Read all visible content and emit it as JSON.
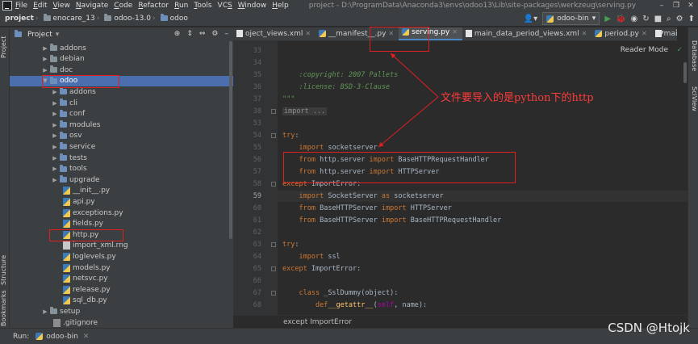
{
  "menu": {
    "items": [
      "File",
      "Edit",
      "View",
      "Navigate",
      "Code",
      "Refactor",
      "Run",
      "Tools",
      "VCS",
      "Window",
      "Help"
    ],
    "underlines": [
      "F",
      "E",
      "V",
      "N",
      "C",
      "R",
      "R",
      "T",
      "S",
      "W",
      "H"
    ],
    "window_title": "project - D:\\ProgramData\\Anaconda3\\envs\\odoo13\\Lib\\site-packages\\werkzeug\\serving.py"
  },
  "nav": {
    "crumbs": [
      "project",
      "enocare_13",
      "odoo-13.0",
      "odoo"
    ],
    "run_config": "odoo-bin"
  },
  "project_panel": {
    "title": "Project",
    "tree": [
      {
        "label": "addons",
        "type": "folder",
        "level": 1,
        "expanded": false
      },
      {
        "label": "debian",
        "type": "folder",
        "level": 1,
        "expanded": false
      },
      {
        "label": "doc",
        "type": "folder",
        "level": 1,
        "expanded": false
      },
      {
        "label": "odoo",
        "type": "folder",
        "level": 1,
        "expanded": true,
        "selected": true
      },
      {
        "label": "addons",
        "type": "folder",
        "level": 2,
        "expanded": false
      },
      {
        "label": "cli",
        "type": "folder",
        "level": 2,
        "expanded": false
      },
      {
        "label": "conf",
        "type": "folder",
        "level": 2,
        "expanded": false
      },
      {
        "label": "modules",
        "type": "folder",
        "level": 2,
        "expanded": false
      },
      {
        "label": "osv",
        "type": "folder",
        "level": 2,
        "expanded": false
      },
      {
        "label": "service",
        "type": "folder",
        "level": 2,
        "expanded": false
      },
      {
        "label": "tests",
        "type": "folder",
        "level": 2,
        "expanded": false
      },
      {
        "label": "tools",
        "type": "folder",
        "level": 2,
        "expanded": false
      },
      {
        "label": "upgrade",
        "type": "folder",
        "level": 2,
        "expanded": false
      },
      {
        "label": "__init__.py",
        "type": "py",
        "level": 2
      },
      {
        "label": "api.py",
        "type": "py",
        "level": 2
      },
      {
        "label": "exceptions.py",
        "type": "py",
        "level": 2
      },
      {
        "label": "fields.py",
        "type": "py",
        "level": 2
      },
      {
        "label": "http.py",
        "type": "py",
        "level": 2
      },
      {
        "label": "import_xml.rng",
        "type": "rng",
        "level": 2
      },
      {
        "label": "loglevels.py",
        "type": "py",
        "level": 2
      },
      {
        "label": "models.py",
        "type": "py",
        "level": 2
      },
      {
        "label": "netsvc.py",
        "type": "py",
        "level": 2
      },
      {
        "label": "release.py",
        "type": "py",
        "level": 2
      },
      {
        "label": "sql_db.py",
        "type": "py",
        "level": 2
      },
      {
        "label": "setup",
        "type": "folder",
        "level": 1,
        "expanded": false
      },
      {
        "label": ".gitignore",
        "type": "git",
        "level": 1
      }
    ]
  },
  "tabs": [
    {
      "label": "oject_views.xml",
      "icon": "xml"
    },
    {
      "label": "__manifest__.py",
      "icon": "py"
    },
    {
      "label": "serving.py",
      "icon": "py",
      "active": true
    },
    {
      "label": "main_data_period_views.xml",
      "icon": "xml"
    },
    {
      "label": "period.py",
      "icon": "py"
    },
    {
      "label": "main_data",
      "icon": "xml"
    }
  ],
  "editor": {
    "reader_mode": "Reader Mode",
    "lines": [
      {
        "n": "33",
        "segs": []
      },
      {
        "n": "34",
        "segs": []
      },
      {
        "n": "35",
        "segs": [
          [
            "cm",
            "    :copyright: 2007 Pallets"
          ]
        ]
      },
      {
        "n": "36",
        "segs": [
          [
            "cm",
            "    :license: BSD-3-Clause"
          ]
        ]
      },
      {
        "n": "37",
        "segs": [
          [
            "cm",
            "\"\"\""
          ]
        ]
      },
      {
        "n": "38",
        "segs": [
          [
            "collapsed",
            "import ..."
          ]
        ]
      },
      {
        "n": "53",
        "segs": []
      },
      {
        "n": "54",
        "segs": [
          [
            "kw",
            "try"
          ],
          [
            "",
            ":"
          ]
        ]
      },
      {
        "n": "55",
        "segs": [
          [
            "",
            "    "
          ],
          [
            "kw",
            "import"
          ],
          [
            "",
            " socketserver"
          ]
        ]
      },
      {
        "n": "56",
        "segs": [
          [
            "",
            "    "
          ],
          [
            "kw",
            "from"
          ],
          [
            "",
            " http.server "
          ],
          [
            "kw",
            "import"
          ],
          [
            "",
            " BaseHTTPRequestHandler"
          ]
        ]
      },
      {
        "n": "57",
        "segs": [
          [
            "",
            "    "
          ],
          [
            "kw",
            "from"
          ],
          [
            "",
            " http.server "
          ],
          [
            "kw",
            "import"
          ],
          [
            "",
            " HTTPServer"
          ]
        ]
      },
      {
        "n": "58",
        "segs": [
          [
            "kw",
            "except"
          ],
          [
            "",
            " ImportError:"
          ]
        ]
      },
      {
        "n": "59",
        "segs": [
          [
            "",
            "    "
          ],
          [
            "kw",
            "import"
          ],
          [
            "",
            " SocketServer "
          ],
          [
            "kw",
            "as"
          ],
          [
            "",
            " socketserver"
          ]
        ],
        "current": true
      },
      {
        "n": "60",
        "segs": [
          [
            "",
            "    "
          ],
          [
            "kw",
            "from"
          ],
          [
            "",
            " BaseHTTPServer "
          ],
          [
            "kw",
            "import"
          ],
          [
            "",
            " HTTPServer"
          ]
        ]
      },
      {
        "n": "61",
        "segs": [
          [
            "",
            "    "
          ],
          [
            "kw",
            "from"
          ],
          [
            "",
            " BaseHTTPServer "
          ],
          [
            "kw",
            "import"
          ],
          [
            "",
            " BaseHTTPRequestHandler"
          ]
        ]
      },
      {
        "n": "62",
        "segs": []
      },
      {
        "n": "63",
        "segs": [
          [
            "kw",
            "try"
          ],
          [
            "",
            ":"
          ]
        ]
      },
      {
        "n": "64",
        "segs": [
          [
            "",
            "    "
          ],
          [
            "kw",
            "import"
          ],
          [
            "",
            " ssl"
          ]
        ]
      },
      {
        "n": "65",
        "segs": [
          [
            "kw",
            "except"
          ],
          [
            "",
            " ImportError:"
          ]
        ]
      },
      {
        "n": "66",
        "segs": []
      },
      {
        "n": "67",
        "segs": [
          [
            "",
            "    "
          ],
          [
            "kw",
            "class"
          ],
          [
            "",
            " _SslDummy(object):"
          ]
        ]
      },
      {
        "n": "68",
        "segs": [
          [
            "",
            "        "
          ],
          [
            "kw",
            "def"
          ],
          [
            " ",
            ""
          ],
          [
            "fn",
            "__getattr__"
          ],
          [
            "",
            "("
          ],
          [
            "mg",
            "self"
          ],
          [
            "",
            ", name):"
          ]
        ]
      }
    ],
    "breadcrumb": "except ImportError"
  },
  "side_tools": {
    "left": [
      "Project",
      "Structure",
      "Bookmarks"
    ],
    "right": [
      "Database",
      "SciView"
    ]
  },
  "runbar": {
    "label": "Run:",
    "config": "odoo-bin"
  },
  "annotation": {
    "text": "文件要导入的是python下的http"
  },
  "watermark": "CSDN @Htojk"
}
